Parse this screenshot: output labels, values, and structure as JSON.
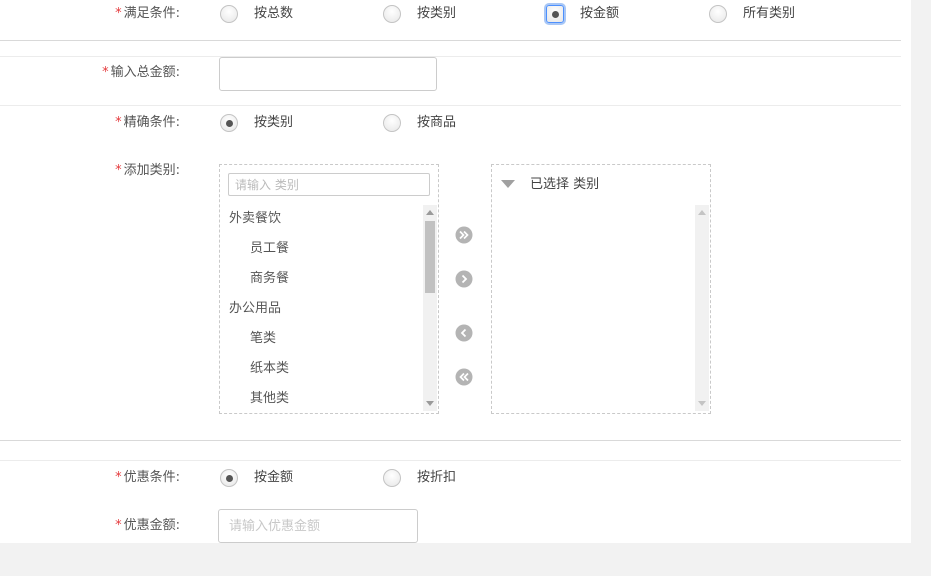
{
  "required_mark": "*",
  "satisfy": {
    "label": "满足条件:",
    "options": [
      "按总数",
      "按类别",
      "按金额",
      "所有类别"
    ],
    "selected": "按金额"
  },
  "total_amount": {
    "label": "输入总金额:",
    "value": ""
  },
  "precise": {
    "label": "精确条件:",
    "options": [
      "按类别",
      "按商品"
    ],
    "selected": "按类别"
  },
  "add_category": {
    "label": "添加类别:",
    "search_placeholder": "请输入 类别",
    "tree": [
      {
        "text": "外卖餐饮",
        "level": 0
      },
      {
        "text": "员工餐",
        "level": 1
      },
      {
        "text": "商务餐",
        "level": 1
      },
      {
        "text": "办公用品",
        "level": 0
      },
      {
        "text": "笔类",
        "level": 1
      },
      {
        "text": "纸本类",
        "level": 1
      },
      {
        "text": "其他类",
        "level": 1
      }
    ],
    "selected_title": "已选择 类别",
    "transfer_icons": [
      "double-right-arrow-icon",
      "right-arrow-icon",
      "left-arrow-icon",
      "double-left-arrow-icon"
    ]
  },
  "discount": {
    "label": "优惠条件:",
    "options": [
      "按金额",
      "按折扣"
    ],
    "selected": "按金额"
  },
  "discount_amount": {
    "label": "优惠金额:",
    "placeholder": "请输入优惠金额"
  },
  "colors": {
    "required": "#e4393c",
    "focus": "#4d90fe",
    "icon_gray": "#b4b4b4"
  }
}
